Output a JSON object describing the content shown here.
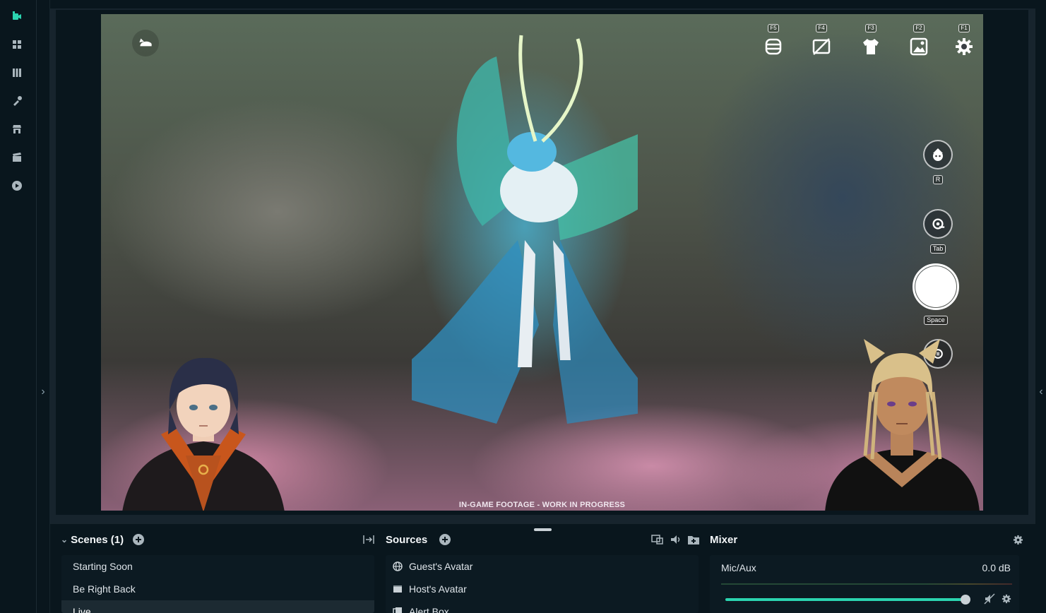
{
  "sidebar": {
    "items": [
      {
        "name": "editor",
        "icon": "camera-icon"
      },
      {
        "name": "layout",
        "icon": "grid-icon"
      },
      {
        "name": "library",
        "icon": "library-icon"
      },
      {
        "name": "themes",
        "icon": "brush-icon"
      },
      {
        "name": "store",
        "icon": "store-icon"
      },
      {
        "name": "highlighter",
        "icon": "clapper-icon"
      },
      {
        "name": "play",
        "icon": "play-icon"
      }
    ]
  },
  "preview": {
    "footage_label": "IN-GAME FOOTAGE - WORK IN PROGRESS",
    "hud_top": [
      {
        "key": "F5",
        "icon": "layers-icon"
      },
      {
        "key": "F4",
        "icon": "hide-ui-icon"
      },
      {
        "key": "F3",
        "icon": "outfit-icon"
      },
      {
        "key": "F2",
        "icon": "image-icon"
      },
      {
        "key": "F1",
        "icon": "settings-icon"
      }
    ],
    "hud_side": {
      "character_key": "R",
      "rotate_key": "Tab",
      "shutter_key": "Space"
    }
  },
  "scenes": {
    "title": "Scenes (1)",
    "items": [
      "Starting Soon",
      "Be Right Back",
      "Live"
    ],
    "selected_index": 2
  },
  "sources": {
    "title": "Sources",
    "items": [
      {
        "label": "Guest's Avatar",
        "icon": "globe-icon"
      },
      {
        "label": "Host's Avatar",
        "icon": "window-icon"
      },
      {
        "label": "Alert Box",
        "icon": "alert-box-icon"
      }
    ]
  },
  "mixer": {
    "title": "Mixer",
    "channel": "Mic/Aux",
    "level": "0.0 dB",
    "volume_fraction": 1.0
  },
  "colors": {
    "accent": "#2bd4b0",
    "background": "#09161d",
    "panel": "#0c1a22"
  }
}
